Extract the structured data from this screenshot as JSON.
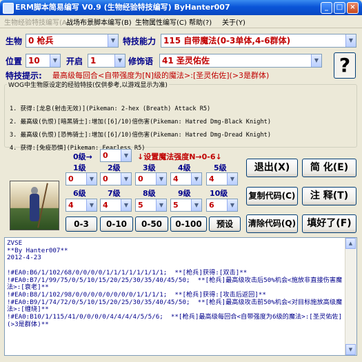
{
  "window": {
    "title": "ERM脚本简易编写 V0.9 (生物经验特技编写) ByHanter007",
    "buttons": {
      "minimize": "_",
      "maximize": "□",
      "close": "×"
    }
  },
  "menu": {
    "items": [
      "生物经验特技编写(A)",
      "战场布景脚本编写(B)",
      "生物属性编写(C)",
      "帮助(?)",
      "关于(Y)"
    ]
  },
  "form": {
    "creature_label": "生物",
    "creature_value": "0 枪兵",
    "ability_label": "特技能力",
    "ability_value": "115 自带魔法(0-3单体,4-6群体)",
    "position_label": "位置",
    "position_value": "10",
    "open_label": "开启",
    "open_value": "1",
    "modifier_label": "修饰语",
    "modifier_value": "41 圣灵佑佐",
    "hint_label": "特技提示:",
    "hint_text": "最高级每回合<自带强度为[N]级的魔法>:[圣灵佑佐](>3是群体)",
    "help_button": "?"
  },
  "skills_group": {
    "title": "WOG中生物原设定的经验特技(仅供参考,以游戏显示为准)",
    "lines": [
      "1. 获得:[龙息(射击无效)](Pikeman: 2-hex (Breath) Attack R5)",
      "2. 最高级(仇恨)[暗黑骑士]:增加([6]/10)倍伤害(Pikeman: Hatred Dmg-Black Knight)",
      "3. 最高级(仇恨)[恐怖骑士]:增加([6]/10)倍伤害(Pikeman: Hatred Dmg-Dread Knight)",
      "4. 获得:[免疫恐惧](Pikeman: Fearless R5)"
    ]
  },
  "levels": {
    "lvl0_label": "0级→",
    "lvl0_value": "0",
    "magic_note": "↓设置魔法强度N→0-6↓",
    "row1": [
      {
        "label": "1级",
        "value": "0"
      },
      {
        "label": "2级",
        "value": "0"
      },
      {
        "label": "3级",
        "value": "0"
      },
      {
        "label": "4级",
        "value": "4"
      },
      {
        "label": "5级",
        "value": "4"
      }
    ],
    "row2": [
      {
        "label": "6级",
        "value": "4"
      },
      {
        "label": "7级",
        "value": "4"
      },
      {
        "label": "8级",
        "value": "5"
      },
      {
        "label": "9级",
        "value": "5"
      },
      {
        "label": "10级",
        "value": "6"
      }
    ],
    "presets": [
      "0-3",
      "0-10",
      "0-50",
      "0-100",
      "预设"
    ]
  },
  "actions": {
    "exit": "退出(X)",
    "simplify": "简 化(E)",
    "copy": "复制代码(C)",
    "comment": "注 释(T)",
    "clear": "清除代码(Q)",
    "filled": "填好了(F)"
  },
  "code": {
    "text": "ZVSE\n**By Hanter007**\n2012-4-23\n\n!#EA0:B6/1/102/68/0/0/0/0/1/1/1/1/1/1/1/1;  **[枪兵]获得:[双击]**\n!#EA0:B7/1/99/75/0/5/10/15/20/25/30/35/40/45/50;  **[枪兵]最高级攻击后50%机会<施放非直接伤害魔法>:[衰老]**\n!#EA0:B8/1/102/98/0/0/0/0/0/0/0/0/1/1/1/1;  **[枪兵]获得:[攻击后返回]**\n!#EA0:B9/1/74/72/0/5/10/15/20/25/30/35/40/45/50;  **[枪兵]最高级攻击前50%机会<对目标施放高级魔法>:[缠绕]**\n!#EA0:B10/1/115/41/0/0/0/0/4/4/4/4/5/5/6;  **[枪兵]最高级每回合<自带强度为6级的魔法>:[圣灵佑佐](>3是群体)**"
  },
  "colors": {
    "title_bar": "#0a55d8",
    "label_blue": "#00008b",
    "value_red": "#c00000",
    "window_bg": "#ece9d8"
  }
}
